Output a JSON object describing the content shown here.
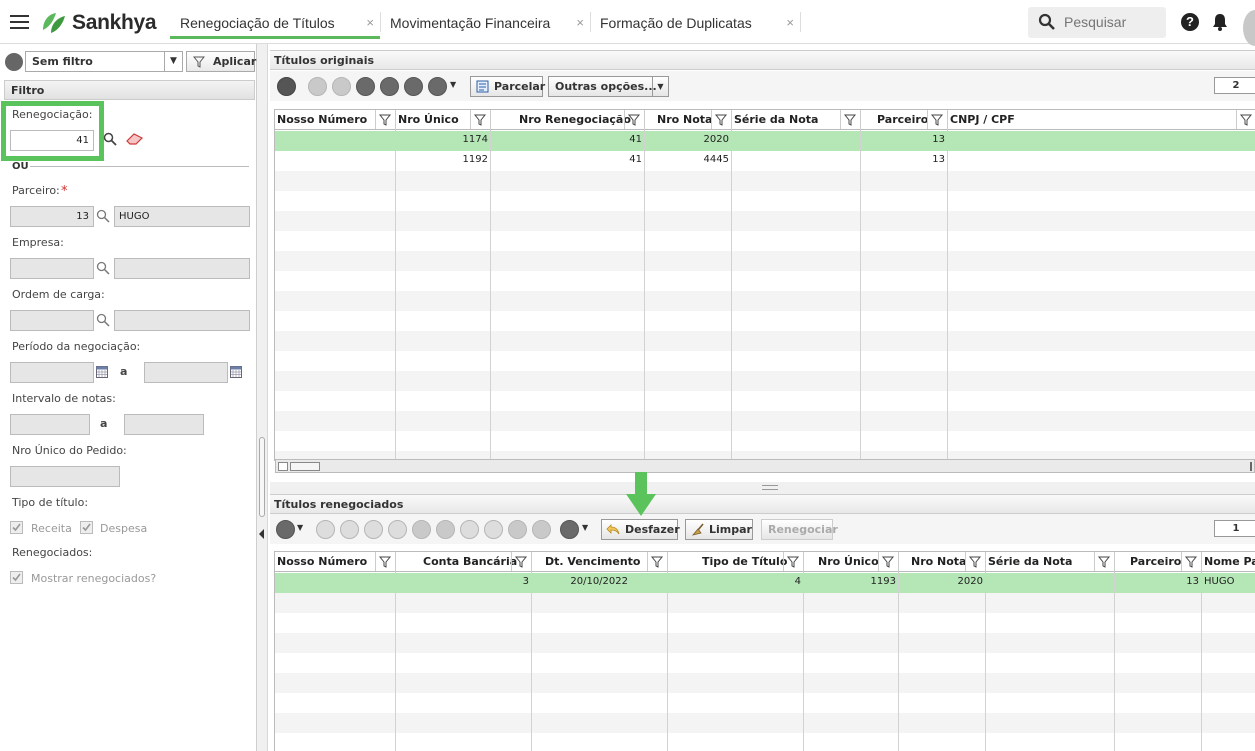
{
  "app": {
    "brand": "Sankhya",
    "tabs": [
      {
        "label": "Renegociação de Títulos",
        "active": true
      },
      {
        "label": "Movimentação Financeira",
        "active": false
      },
      {
        "label": "Formação de Duplicatas",
        "active": false
      }
    ],
    "search_placeholder": "Pesquisar",
    "close_glyph": "×"
  },
  "filter": {
    "preset": "Sem filtro",
    "apply_label": "Aplicar",
    "section_title": "Filtro",
    "renegociacao_label": "Renegociação:",
    "renegociacao_value": "41",
    "or_label": "OU",
    "parceiro_label": "Parceiro:",
    "required_mark": "*",
    "parceiro_code": "13",
    "parceiro_name": "HUGO",
    "empresa_label": "Empresa:",
    "ordem_carga_label": "Ordem de carga:",
    "periodo_label": "Período da negociação:",
    "periodo_sep": "a",
    "intervalo_label": "Intervalo de notas:",
    "intervalo_sep": "a",
    "nro_pedido_label": "Nro Único do Pedido:",
    "tipo_titulo_label": "Tipo de título:",
    "receita_label": "Receita",
    "despesa_label": "Despesa",
    "renegociados_label": "Renegociados:",
    "mostrar_label": "Mostrar renegociados?"
  },
  "originais": {
    "title": "Títulos originais",
    "parcelar_label": "Parcelar",
    "outras_label": "Outras opções...",
    "page": "2",
    "columns": [
      "Nosso Número",
      "Nro Único",
      "Nro Renegociação",
      "Nro Nota",
      "Série da Nota",
      "Parceiro",
      "CNPJ / CPF"
    ],
    "rows": [
      {
        "nosso": "",
        "nro_unico": "1174",
        "nro_reneg": "41",
        "nro_nota": "2020",
        "serie": "",
        "parceiro": "13",
        "cnpj": ""
      },
      {
        "nosso": "",
        "nro_unico": "1192",
        "nro_reneg": "41",
        "nro_nota": "4445",
        "serie": "",
        "parceiro": "13",
        "cnpj": ""
      }
    ]
  },
  "renegociados": {
    "title": "Títulos renegociados",
    "desfazer_label": "Desfazer",
    "limpar_label": "Limpar",
    "renegociar_label": "Renegociar",
    "page": "1",
    "columns": [
      "Nosso Número",
      "Conta Bancária",
      "Dt. Vencimento",
      "Tipo de Título",
      "Nro Único",
      "Nro Nota",
      "Série da Nota",
      "Parceiro",
      "Nome Par"
    ],
    "rows": [
      {
        "nosso": "",
        "conta": "3",
        "dt_venc": "20/10/2022",
        "tipo": "4",
        "nro_unico": "1193",
        "nro_nota": "2020",
        "serie": "",
        "parceiro": "13",
        "nome": "HUGO"
      }
    ]
  },
  "colors": {
    "accent_green": "#5bb85c",
    "selected_row": "#b5e6b5",
    "highlight_box": "#5bc35b"
  }
}
